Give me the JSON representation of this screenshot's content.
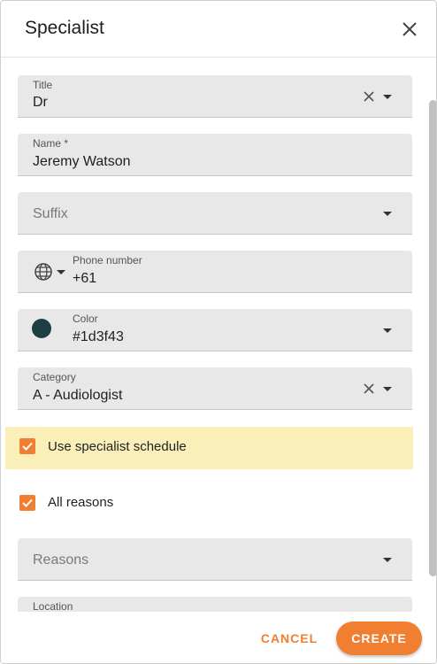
{
  "dialog": {
    "title": "Specialist",
    "close_icon": "close-icon"
  },
  "fields": {
    "title": {
      "label": "Title",
      "value": "Dr"
    },
    "name": {
      "label": "Name *",
      "value": "Jeremy Watson"
    },
    "suffix": {
      "placeholder": "Suffix"
    },
    "phone": {
      "label": "Phone number",
      "value": "+61",
      "icon": "globe-icon"
    },
    "color": {
      "label": "Color",
      "value": "#1d3f43",
      "swatch": "#1d3f43"
    },
    "category": {
      "label": "Category",
      "value": "A - Audiologist"
    },
    "reasons": {
      "placeholder": "Reasons"
    },
    "location": {
      "label": "Location"
    }
  },
  "checkboxes": {
    "use_schedule": {
      "label": "Use specialist schedule",
      "checked": true
    },
    "all_reasons": {
      "label": "All reasons",
      "checked": true
    }
  },
  "footer": {
    "cancel_label": "CANCEL",
    "create_label": "CREATE"
  },
  "colors": {
    "accent": "#f07f32",
    "highlight_row": "#faefb9",
    "field_bg": "#e8e8e8"
  }
}
